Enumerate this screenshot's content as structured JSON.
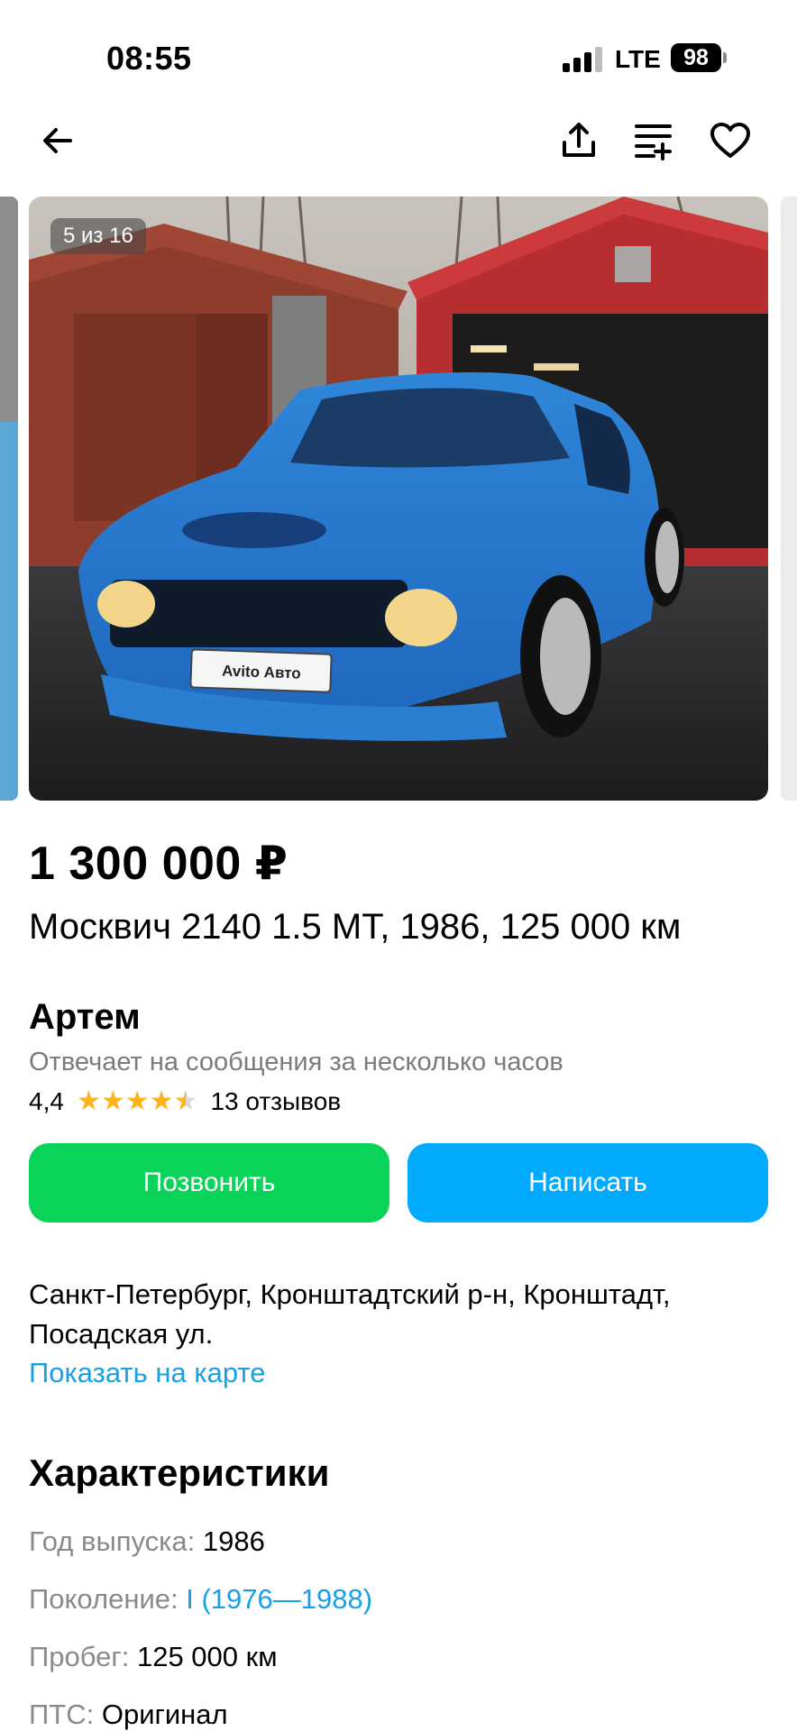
{
  "status_bar": {
    "time": "08:55",
    "network": "LTE",
    "battery": "98"
  },
  "header": {
    "back_icon": "arrow-left-icon",
    "share_icon": "share-icon",
    "compare_icon": "compare-icon",
    "favorite_icon": "heart-icon"
  },
  "gallery": {
    "counter": "5 из 16",
    "plate_text": "Avito Авто"
  },
  "listing": {
    "price": "1 300 000 ₽",
    "title": "Москвич 2140 1.5 MT, 1986, 125 000 км"
  },
  "seller": {
    "name": "Артем",
    "response": "Отвечает на сообщения за несколько часов",
    "rating": "4,4",
    "rating_value": 4.4,
    "reviews": "13 отзывов"
  },
  "actions": {
    "call_label": "Позвонить",
    "message_label": "Написать"
  },
  "location": {
    "address": "Санкт-Петербург, Кронштадтский р-н, Кронштадт, Посадская ул.",
    "map_link": "Показать на карте"
  },
  "specs": {
    "title": "Характеристики",
    "items": [
      {
        "label": "Год выпуска:",
        "value": "1986"
      },
      {
        "label": "Поколение:",
        "value": "I (1976—1988)"
      },
      {
        "label": "Пробег:",
        "value": "125 000 км"
      },
      {
        "label": "ПТС:",
        "value": "Оригинал"
      }
    ]
  },
  "colors": {
    "call": "#0ad35a",
    "message": "#00aaff",
    "link": "#18a0e6",
    "star": "#ffb31a"
  }
}
